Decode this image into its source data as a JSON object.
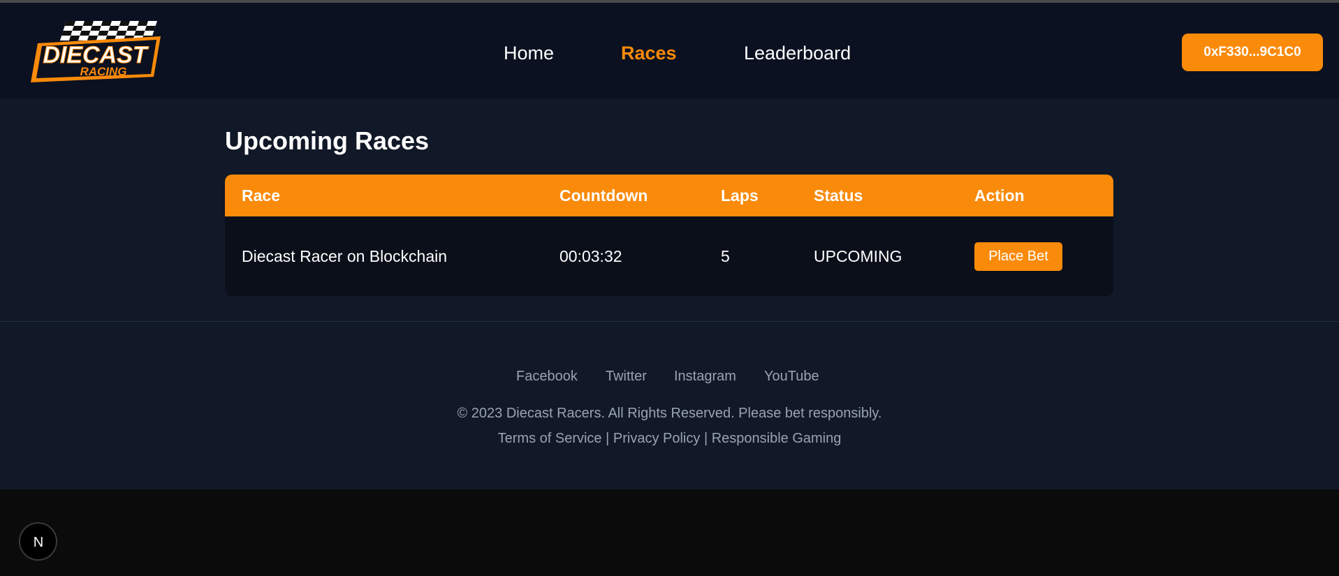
{
  "brand": {
    "logo_word_1": "DIECAST",
    "logo_word_2": "RACING",
    "accent_color": "#fa8a0a",
    "header_bg": "#0b1120",
    "page_bg": "#111827"
  },
  "nav": {
    "items": [
      {
        "label": "Home",
        "active": false
      },
      {
        "label": "Races",
        "active": true
      },
      {
        "label": "Leaderboard",
        "active": false
      }
    ]
  },
  "wallet": {
    "label": "0xF330...9C1C0"
  },
  "main": {
    "title": "Upcoming Races",
    "table": {
      "headers": [
        "Race",
        "Countdown",
        "Laps",
        "Status",
        "Action"
      ],
      "rows": [
        {
          "race": "Diecast Racer on Blockchain",
          "countdown": "00:03:32",
          "laps": "5",
          "status": "UPCOMING",
          "action_label": "Place Bet"
        }
      ]
    }
  },
  "footer": {
    "social": [
      "Facebook",
      "Twitter",
      "Instagram",
      "YouTube"
    ],
    "copyright": "© 2023 Diecast Racers. All Rights Reserved. Please bet responsibly.",
    "legal": [
      "Terms of Service",
      "Privacy Policy",
      "Responsible Gaming"
    ],
    "separator": "|"
  },
  "dev_badge": {
    "icon": "nextjs-icon",
    "letter": "N"
  }
}
